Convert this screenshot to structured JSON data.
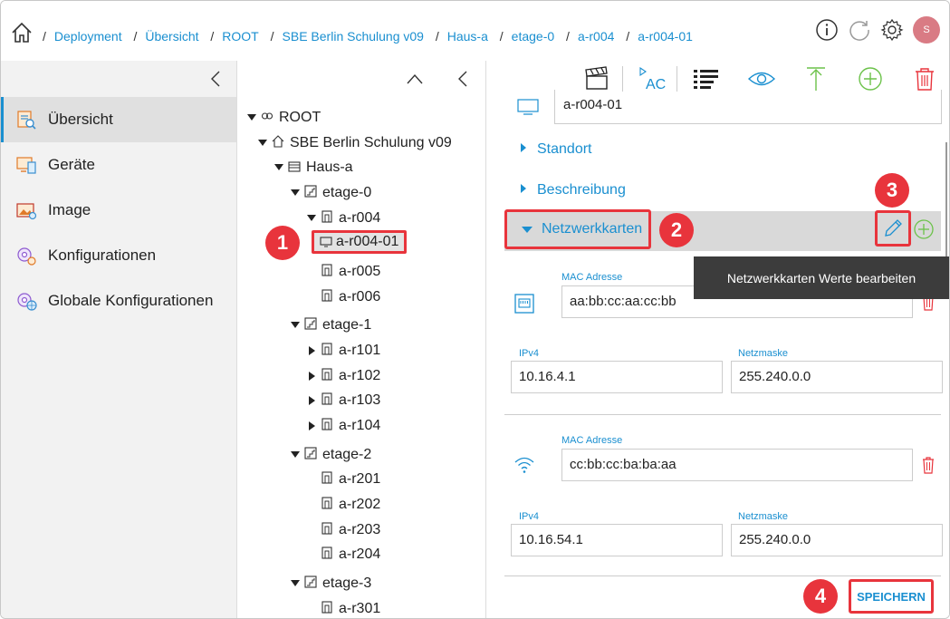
{
  "breadcrumb": {
    "items": [
      "Deployment",
      "Übersicht",
      "ROOT",
      "SBE Berlin Schulung v09",
      "Haus-a",
      "etage-0",
      "a-r004",
      "a-r004-01"
    ],
    "separator": "/"
  },
  "header": {
    "avatar_initial": "S",
    "icons": [
      "info-icon",
      "refresh-icon",
      "gear-icon"
    ]
  },
  "sidebar": {
    "items": [
      {
        "label": "Übersicht",
        "icon": "overview-icon",
        "active": true
      },
      {
        "label": "Geräte",
        "icon": "devices-icon",
        "active": false
      },
      {
        "label": "Image",
        "icon": "image-icon",
        "active": false
      },
      {
        "label": "Konfigurationen",
        "icon": "config-icon",
        "active": false
      },
      {
        "label": "Globale Konfigurationen",
        "icon": "global-config-icon",
        "active": false
      }
    ]
  },
  "tree": {
    "nodes": [
      {
        "label": "ROOT"
      },
      {
        "label": "SBE Berlin Schulung v09"
      },
      {
        "label": "Haus-a"
      },
      {
        "label": "etage-0"
      },
      {
        "label": "a-r004"
      },
      {
        "label": "a-r004-01",
        "selected": true
      },
      {
        "label": "a-r005"
      },
      {
        "label": "a-r006"
      },
      {
        "label": "etage-1"
      },
      {
        "label": "a-r101"
      },
      {
        "label": "a-r102"
      },
      {
        "label": "a-r103"
      },
      {
        "label": "a-r104"
      },
      {
        "label": "etage-2"
      },
      {
        "label": "a-r201"
      },
      {
        "label": "a-r202"
      },
      {
        "label": "a-r203"
      },
      {
        "label": "a-r204"
      },
      {
        "label": "etage-3"
      },
      {
        "label": "a-r301"
      }
    ]
  },
  "toolbar": {
    "icons": [
      "clapper-icon",
      "ac-icon",
      "list-icon",
      "eye-icon",
      "upload-icon",
      "add-icon",
      "delete-icon"
    ]
  },
  "device": {
    "name": "a-r004-01"
  },
  "sections": {
    "standort": "Standort",
    "beschreibung": "Beschreibung",
    "netzwerkkarten": "Netzwerkkarten"
  },
  "tooltip": "Netzwerkkarten Werte bearbeiten",
  "nics": [
    {
      "type": "ethernet",
      "mac_label": "MAC Adresse",
      "mac": "aa:bb:cc:aa:cc:bb",
      "ipv4_label": "IPv4",
      "ipv4": "10.16.4.1",
      "mask_label": "Netzmaske",
      "mask": "255.240.0.0"
    },
    {
      "type": "wifi",
      "mac_label": "MAC Adresse",
      "mac": "cc:bb:cc:ba:ba:aa",
      "ipv4_label": "IPv4",
      "ipv4": "10.16.54.1",
      "mask_label": "Netzmaske",
      "mask": "255.240.0.0"
    }
  ],
  "save_label": "SPEICHERN",
  "badges": [
    "1",
    "2",
    "3",
    "4"
  ],
  "colors": {
    "accent": "#1a8fd0",
    "highlight": "#e8343c",
    "green": "#6cc24a"
  }
}
